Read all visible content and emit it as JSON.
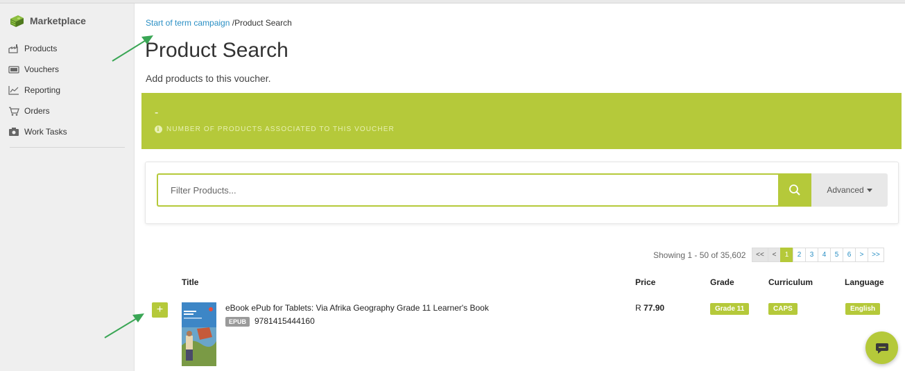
{
  "sidebar": {
    "brand": "Marketplace",
    "items": [
      {
        "label": "Products",
        "icon": "factory-icon"
      },
      {
        "label": "Vouchers",
        "icon": "voucher-icon"
      },
      {
        "label": "Reporting",
        "icon": "chart-line-icon"
      },
      {
        "label": "Orders",
        "icon": "cart-icon"
      },
      {
        "label": "Work Tasks",
        "icon": "camera-icon"
      }
    ]
  },
  "breadcrumb": {
    "parent": "Start of term campaign",
    "current": "/Product Search"
  },
  "page": {
    "title": "Product Search",
    "subtitle": "Add products to this voucher."
  },
  "banner": {
    "count": "-",
    "note": "NUMBER OF PRODUCTS ASSOCIATED TO THIS VOUCHER"
  },
  "filter": {
    "placeholder": "Filter Products...",
    "advanced_label": "Advanced"
  },
  "pagination": {
    "showing": "Showing 1 - 50 of 35,602",
    "first": "<<",
    "prev": "<",
    "pages": [
      "1",
      "2",
      "3",
      "4",
      "5",
      "6"
    ],
    "active_page": "1",
    "next": ">",
    "last": ">>"
  },
  "table": {
    "headers": {
      "title": "Title",
      "price": "Price",
      "grade": "Grade",
      "curriculum": "Curriculum",
      "language": "Language"
    },
    "rows": [
      {
        "add_label": "+",
        "title": "eBook ePub for Tablets: Via Afrika Geography Grade 11 Learner's Book",
        "format": "EPUB",
        "isbn": "9781415444160",
        "currency": "R",
        "price": "77.90",
        "grade": "Grade 11",
        "curriculum": "CAPS",
        "language": "English"
      }
    ]
  },
  "colors": {
    "accent": "#b5c93a",
    "link": "#2a8fc4",
    "sidebar_bg": "#efefef"
  }
}
